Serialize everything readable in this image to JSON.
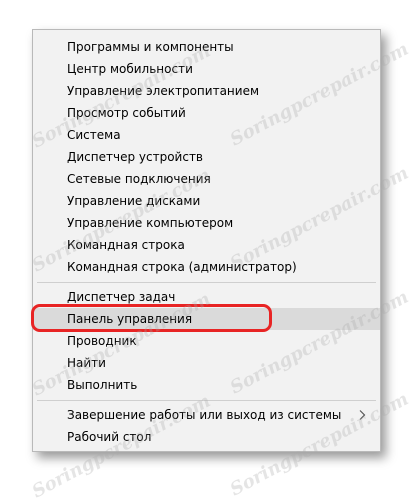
{
  "context_menu": {
    "items": [
      {
        "label": "Программы и компоненты"
      },
      {
        "label": "Центр мобильности"
      },
      {
        "label": "Управление электропитанием"
      },
      {
        "label": "Просмотр событий"
      },
      {
        "label": "Система"
      },
      {
        "label": "Диспетчер устройств"
      },
      {
        "label": "Сетевые подключения"
      },
      {
        "label": "Управление дисками"
      },
      {
        "label": "Управление компьютером"
      },
      {
        "label": "Командная строка"
      },
      {
        "label": "Командная строка (администратор)"
      },
      {
        "label": "Диспетчер задач"
      },
      {
        "label": "Панель управления",
        "hovered": true
      },
      {
        "label": "Проводник"
      },
      {
        "label": "Найти"
      },
      {
        "label": "Выполнить"
      },
      {
        "label": "Завершение работы или выход из системы",
        "has_submenu": true
      },
      {
        "label": "Рабочий стол"
      }
    ]
  },
  "highlight_color": "#e82424",
  "hover_color": "#dadada",
  "watermark": "Soringpcrepair.com",
  "submenu_icon": "chevron-right-icon"
}
